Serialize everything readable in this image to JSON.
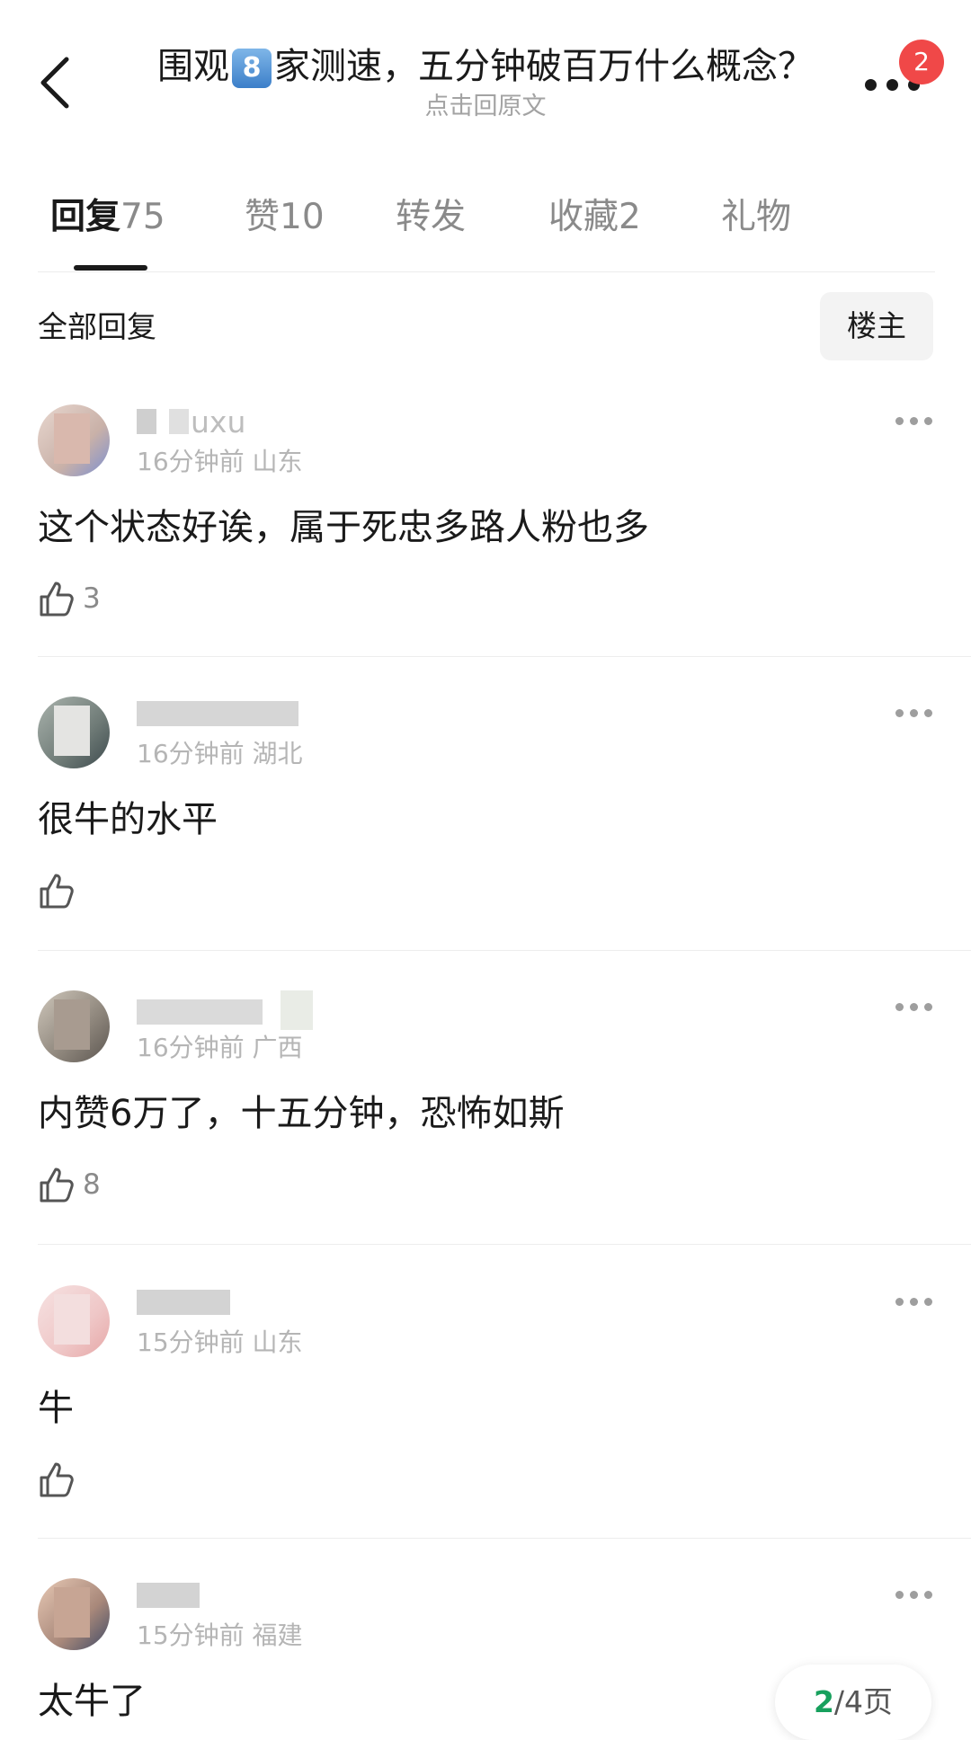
{
  "header": {
    "title_part1": "围观",
    "title_badge": "8",
    "title_part2": "家测速，五分钟破百万什么概念？",
    "subtitle": "点击回原文",
    "notification_count": "2"
  },
  "tabs": [
    {
      "label": "回复",
      "count": "75",
      "active": true
    },
    {
      "label": "赞",
      "count": "10",
      "active": false
    },
    {
      "label": "转发",
      "count": "",
      "active": false
    },
    {
      "label": "收藏",
      "count": "2",
      "active": false
    },
    {
      "label": "礼物",
      "count": "",
      "active": false
    }
  ],
  "filter": {
    "section_title": "全部回复",
    "owner_button": "楼主"
  },
  "comments": [
    {
      "username_visible": "uxu",
      "time": "16分钟前",
      "location": "山东",
      "content": "这个状态好诶，属于死忠多路人粉也多",
      "likes": "3"
    },
    {
      "username_visible": "",
      "time": "16分钟前",
      "location": "湖北",
      "content": "很牛的水平",
      "likes": ""
    },
    {
      "username_visible": "",
      "time": "16分钟前",
      "location": "广西",
      "content": "内赞6万了，十五分钟，恐怖如斯",
      "likes": "8"
    },
    {
      "username_visible": "",
      "time": "15分钟前",
      "location": "山东",
      "content": "牛",
      "likes": ""
    },
    {
      "username_visible": "",
      "time": "15分钟前",
      "location": "福建",
      "content": "太牛了",
      "likes": ""
    }
  ],
  "pagination": {
    "current": "2",
    "total_text": "/4页"
  }
}
